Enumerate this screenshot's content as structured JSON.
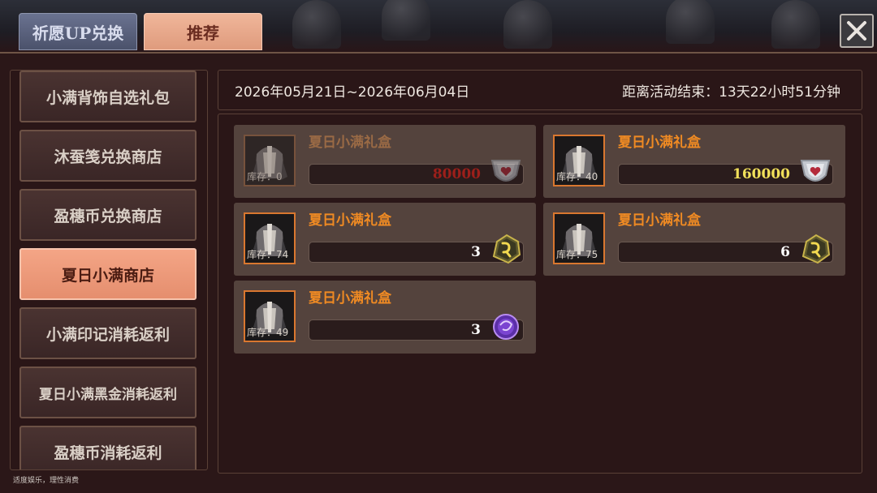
{
  "tabs": [
    {
      "label": "祈愿UP兑换"
    },
    {
      "label": "推荐"
    }
  ],
  "sidebar": {
    "items": [
      {
        "label": "小满背饰自选礼包"
      },
      {
        "label": "沐蚕笺兑换商店"
      },
      {
        "label": "盈穗币兑换商店"
      },
      {
        "label": "夏日小满商店"
      },
      {
        "label": "小满印记消耗返利"
      },
      {
        "label": "夏日小满黑金消耗返利"
      },
      {
        "label": "盈穗币消耗返利"
      }
    ],
    "active_index": 3
  },
  "footer": {
    "notice": "适度娱乐，理性消费"
  },
  "event": {
    "date_range": "2026年05月21日~2026年06月04日",
    "countdown": "距离活动结束：13天22小时51分钟"
  },
  "items": [
    {
      "title": "夏日小满礼盒",
      "stock": "库存：0",
      "price": "80000",
      "currency_icon": "silver-shield-heart-icon",
      "sold_out": true
    },
    {
      "title": "夏日小满礼盒",
      "stock": "库存：40",
      "price": "160000",
      "currency_icon": "silver-shield-heart-icon",
      "sold_out": false
    },
    {
      "title": "夏日小满礼盒",
      "stock": "库存：74",
      "price": "3",
      "currency_icon": "gold-rune-stone-icon",
      "sold_out": false
    },
    {
      "title": "夏日小满礼盒",
      "stock": "库存：75",
      "price": "6",
      "currency_icon": "gold-rune-stone-icon",
      "sold_out": false
    },
    {
      "title": "夏日小满礼盒",
      "stock": "库存：49",
      "price": "3",
      "currency_icon": "purple-orb-icon",
      "sold_out": false
    }
  ],
  "colors": {
    "title_orange": "#ef8a23",
    "price_red": "#9c1f1a",
    "price_yellow": "#f1e05a",
    "active_tab": "#e58e6e"
  }
}
